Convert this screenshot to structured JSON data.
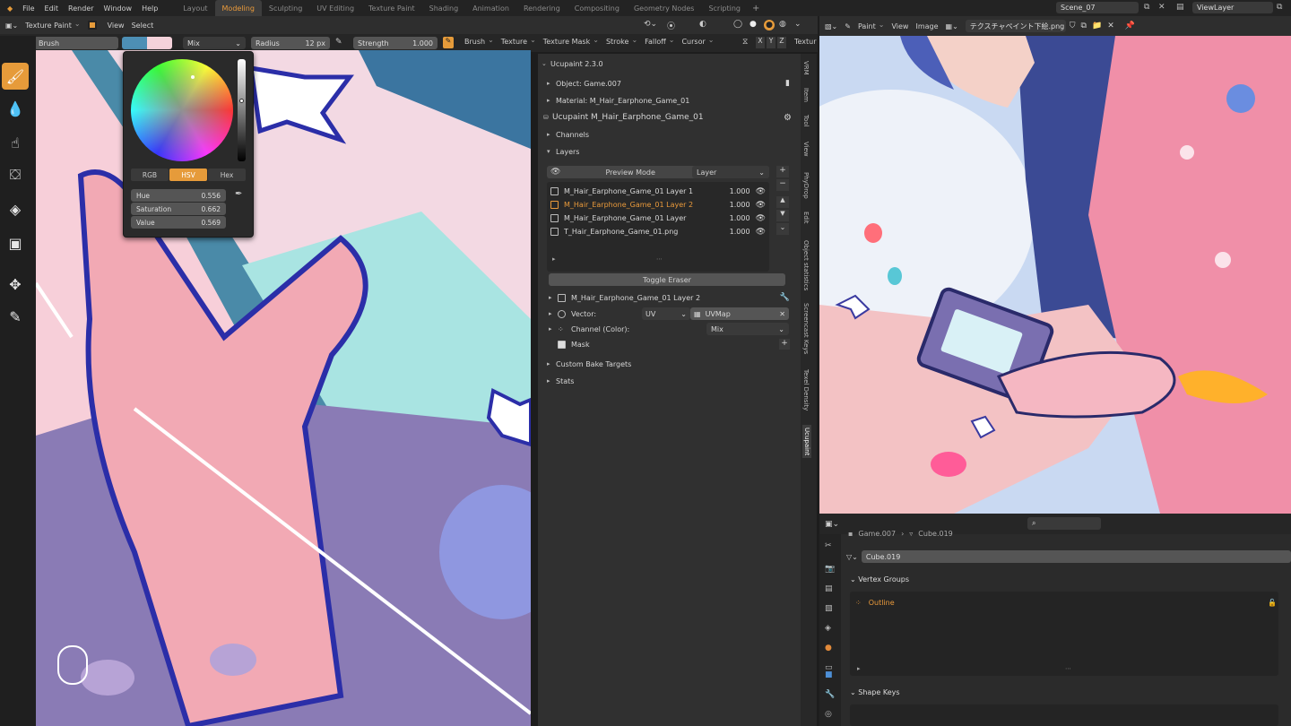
{
  "menubar": [
    "File",
    "Edit",
    "Render",
    "Window",
    "Help"
  ],
  "workspaces": [
    "Layout",
    "Modeling",
    "Sculpting",
    "UV Editing",
    "Texture Paint",
    "Shading",
    "Animation",
    "Rendering",
    "Compositing",
    "Geometry Nodes",
    "Scripting"
  ],
  "active_workspace": "Modeling",
  "scene": "Scene_07",
  "view_layer": "ViewLayer",
  "left_header": {
    "mode": "Texture Paint",
    "view": "View",
    "select": "Select"
  },
  "tool_settings": {
    "brush_label": "Brush",
    "blend": "Mix",
    "radius_label": "Radius",
    "radius_value": "12 px",
    "strength_label": "Strength",
    "strength_value": "1.000",
    "menus": [
      "Brush",
      "Texture",
      "Texture Mask",
      "Stroke",
      "Falloff",
      "Cursor"
    ],
    "axes": [
      "X",
      "Y",
      "Z"
    ],
    "tail": "Textur"
  },
  "color_picker": {
    "modes": [
      "RGB",
      "HSV",
      "Hex"
    ],
    "active_mode": "HSV",
    "hue_label": "Hue",
    "hue": "0.556",
    "saturation_label": "Saturation",
    "saturation": "0.662",
    "value_label": "Value",
    "value": "0.569"
  },
  "sidebar_tabs": [
    "VRM",
    "Item",
    "Tool",
    "View",
    "PhyDrop",
    "Edit",
    "Object statistics",
    "Screencast Keys",
    "Texel Density",
    "Ucupaint"
  ],
  "ucupaint": {
    "title": "Ucupaint 2.3.0",
    "object": "Object: Game.007",
    "material": "Material: M_Hair_Earphone_Game_01",
    "node": "Ucupaint M_Hair_Earphone_Game_01",
    "channels": "Channels",
    "layers": "Layers",
    "preview_mode": "Preview Mode",
    "layer_dropdown": "Layer",
    "layer_list": [
      {
        "name": "M_Hair_Earphone_Game_01 Layer 1",
        "opacity": "1.000"
      },
      {
        "name": "M_Hair_Earphone_Game_01 Layer 2",
        "opacity": "1.000"
      },
      {
        "name": "M_Hair_Earphone_Game_01 Layer",
        "opacity": "1.000"
      },
      {
        "name": "T_Hair_Earphone_Game_01.png",
        "opacity": "1.000"
      }
    ],
    "toggle_eraser": "Toggle Eraser",
    "active_layer": "M_Hair_Earphone_Game_01 Layer 2",
    "vector_label": "Vector:",
    "vector_type": "UV",
    "uv_map": "UVMap",
    "channel_color": "Channel (Color):",
    "channel_blend": "Mix",
    "mask": "Mask",
    "custom_bake": "Custom Bake Targets",
    "stats": "Stats"
  },
  "image_editor": {
    "mode": "Paint",
    "view": "View",
    "image": "Image",
    "image_name": "テクスチャペイント下絵.png"
  },
  "properties": {
    "breadcrumb_obj": "Game.007",
    "breadcrumb_mesh": "Cube.019",
    "mesh_name": "Cube.019",
    "vertex_groups": "Vertex Groups",
    "group": "Outline",
    "shape_keys": "Shape Keys"
  },
  "colors": {
    "accent": "#e69b3a",
    "selected_text": "#ea9a3b",
    "header": "#2e2e2e",
    "panel": "#303030"
  }
}
